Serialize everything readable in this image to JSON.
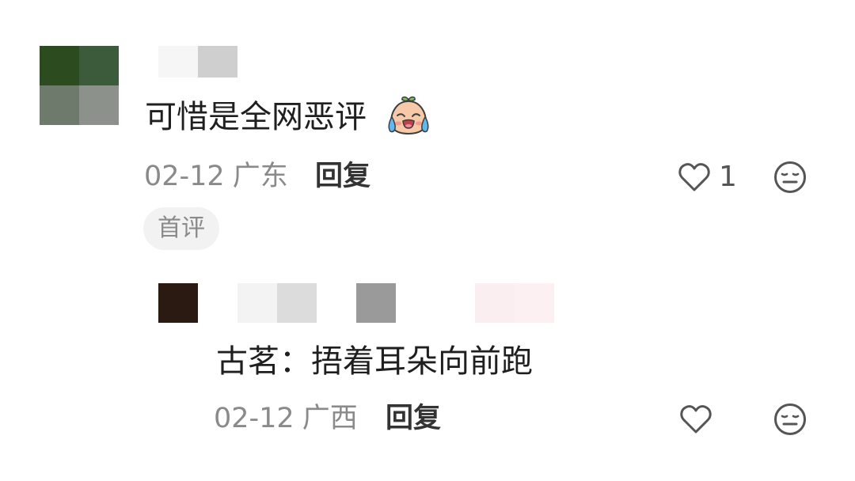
{
  "comment": {
    "text": "可惜是全网恶评",
    "emoji": "crying-face-emoji",
    "date": "02-12",
    "location": "广东",
    "reply_label": "回复",
    "like_count": "1",
    "badge": "首评"
  },
  "reply": {
    "text": "古茗：捂着耳朵向前跑",
    "date": "02-12",
    "location": "广西",
    "reply_label": "回复"
  },
  "colors": {
    "text": "#1f1f1f",
    "meta": "#8a8a8a",
    "icon": "#555555",
    "badge_bg": "#f2f2f2"
  }
}
